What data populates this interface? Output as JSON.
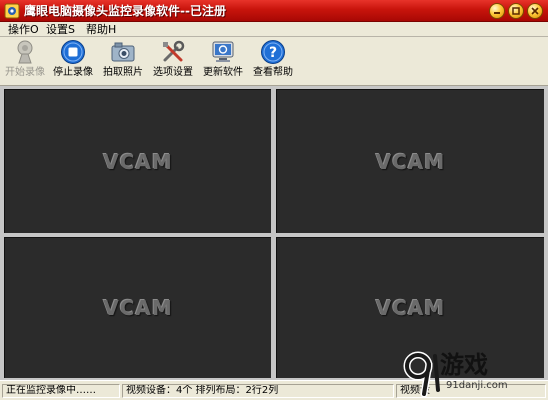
{
  "window": {
    "title": "鹰眼电脑摄像头监控录像软件--已注册",
    "icons": [
      "app-icon",
      "minimize-icon",
      "maximize-icon",
      "close-icon"
    ]
  },
  "menu": {
    "items": [
      {
        "label": "操作O"
      },
      {
        "label": "设置S"
      },
      {
        "label": "帮助H"
      }
    ]
  },
  "toolbar": {
    "buttons": [
      {
        "label": "开始录像",
        "icon": "camera-record-icon",
        "enabled": false
      },
      {
        "label": "停止录像",
        "icon": "stop-icon",
        "enabled": true
      },
      {
        "label": "拍取照片",
        "icon": "photo-camera-icon",
        "enabled": true
      },
      {
        "label": "选项设置",
        "icon": "tools-icon",
        "enabled": true
      },
      {
        "label": "更新软件",
        "icon": "update-icon",
        "enabled": true
      },
      {
        "label": "查看帮助",
        "icon": "help-icon",
        "enabled": true
      }
    ]
  },
  "video": {
    "panes": [
      {
        "label": "VCAM"
      },
      {
        "label": "VCAM"
      },
      {
        "label": "VCAM"
      },
      {
        "label": "VCAM"
      }
    ]
  },
  "status": {
    "state": "正在监控录像中……",
    "devices": "视频设备：4个  排列布局：2行2列",
    "third": "视频设"
  },
  "watermark": {
    "brand": "游戏",
    "site": "91danji.com"
  },
  "colors": {
    "titlebar": "#c8140c",
    "window_bg": "#ece9d8",
    "pane_bg": "#2b2b2b",
    "help_blue": "#1f6fd6"
  }
}
